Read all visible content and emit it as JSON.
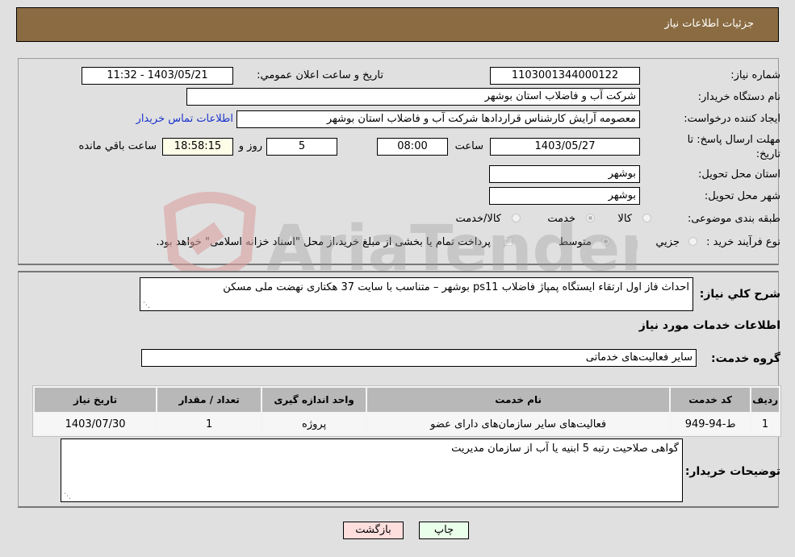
{
  "header": {
    "title": "جزئیات اطلاعات نیاز"
  },
  "form": {
    "need_number": {
      "label": "شماره نیاز:",
      "value": "1103001344000122"
    },
    "announce_datetime": {
      "label": "تاریخ و ساعت اعلان عمومي:",
      "value": "1403/05/21 - 11:32"
    },
    "buyer_org": {
      "label": "نام دستگاه خریدار:",
      "value": "شرکت آب و فاضلاب استان بوشهر"
    },
    "requester": {
      "label": "ایجاد کننده درخواست:",
      "value": "معصومه آرایش کارشناس قراردادها شرکت آب و فاضلاب استان بوشهر"
    },
    "buyer_contact_link": "اطلاعات تماس خریدار",
    "deadline": {
      "label": "مهلت ارسال پاسخ: تا تاریخ:",
      "date": "1403/05/27",
      "time_label": "ساعت",
      "time": "08:00",
      "days": "5",
      "days_label": "روز و",
      "remaining": "18:58:15",
      "remaining_label": "ساعت باقي مانده"
    },
    "delivery_province": {
      "label": "استان محل تحویل:",
      "value": "بوشهر"
    },
    "delivery_city": {
      "label": "شهر محل تحویل:",
      "value": "بوشهر"
    },
    "category": {
      "label": "طبقه بندی موضوعی:",
      "options": [
        "کالا",
        "خدمت",
        "کالا/خدمت"
      ],
      "selected": "خدمت"
    },
    "purchase_type": {
      "label": "نوع فرآیند خرید :",
      "options": [
        "جزيي",
        "متوسط"
      ],
      "selected": "متوسط",
      "treasury_note": "پرداخت تمام یا بخشی از مبلغ خرید،از محل \"اسناد خزانه اسلامی\" خواهد بود.",
      "treasury_checked": true
    }
  },
  "details": {
    "description_label": "شرح کلي نیاز:",
    "description": "احداث فاز اول ارتقاء ایستگاه پمپاژ فاضلاب ps11 بوشهر – متناسب با سایت 37 هکتاری نهضت ملی مسکن",
    "services_heading": "اطلاعات خدمات مورد نیاز",
    "service_group_label": "گروه خدمت:",
    "service_group": "سایر فعالیت‌های خدماتی",
    "table": {
      "headers": [
        "ردیف",
        "کد خدمت",
        "نام خدمت",
        "واحد اندازه گیری",
        "تعداد / مقدار",
        "تاریخ نیاز"
      ],
      "rows": [
        [
          "1",
          "ط-94-949",
          "فعالیت‌های سایر سازمان‌های دارای عضو",
          "پروژه",
          "1",
          "1403/07/30"
        ]
      ]
    },
    "buyer_notes_label": "توضیحات خریدار:",
    "buyer_notes": "گواهی صلاحیت رتبه 5 ابنیه یا آب از سازمان مدیریت"
  },
  "buttons": {
    "print": "چاپ",
    "back": "بازگشت"
  },
  "watermark": "AriaTender.neT",
  "colors": {
    "header_bg": "#8b6c42",
    "print_bg": "#eaffea",
    "back_bg": "#ffdede",
    "link": "#1a33cc"
  }
}
